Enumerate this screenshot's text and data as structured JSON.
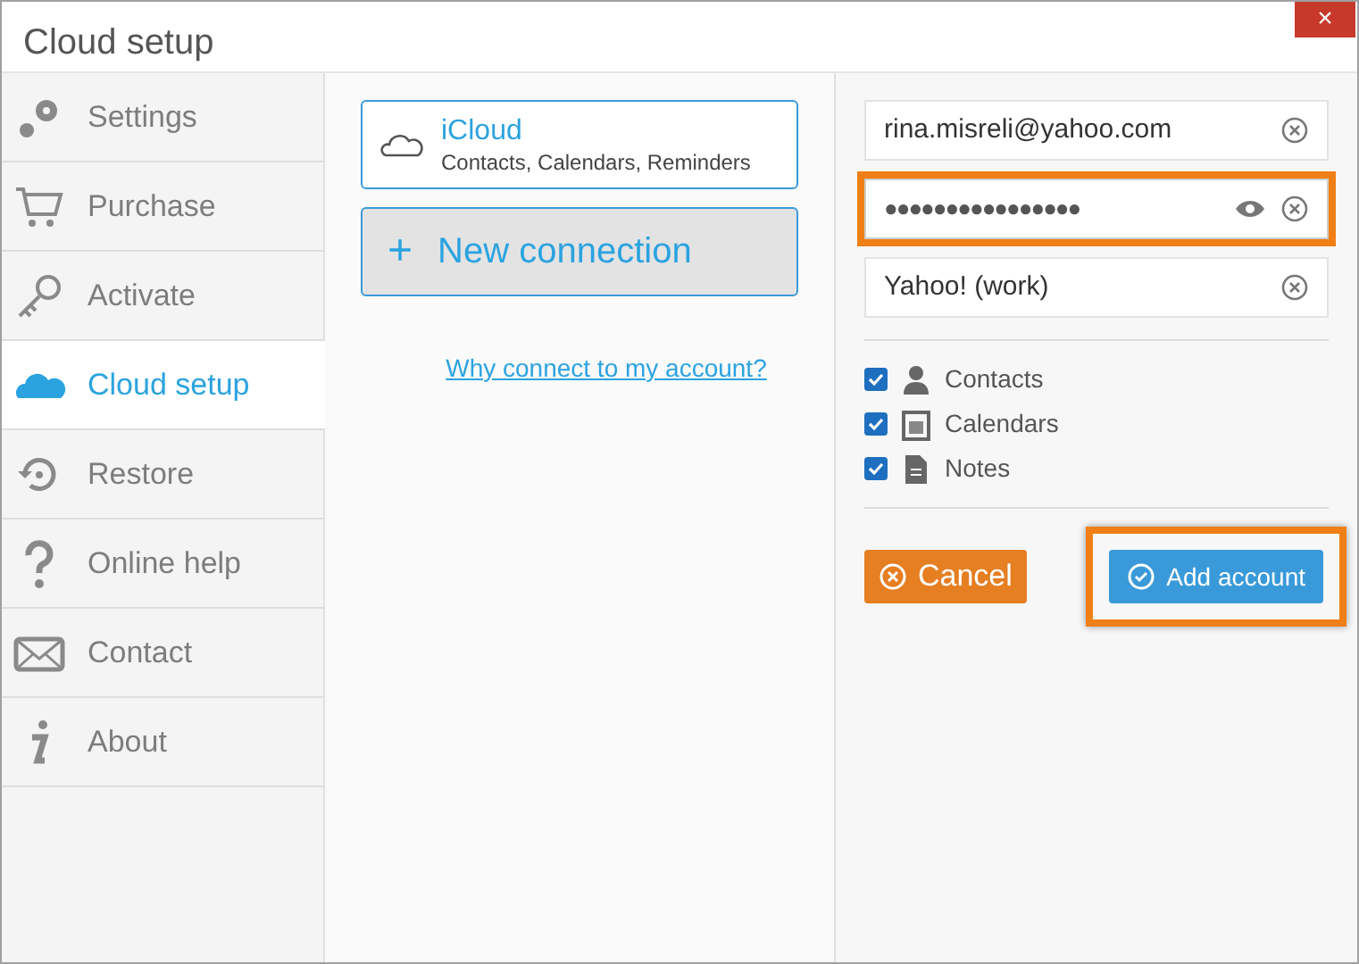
{
  "window": {
    "title": "Cloud setup",
    "close_label": "×"
  },
  "sidebar": {
    "items": [
      {
        "label": "Settings",
        "kind": "gear",
        "selected": false
      },
      {
        "label": "Purchase",
        "kind": "cart",
        "selected": false
      },
      {
        "label": "Activate",
        "kind": "key",
        "selected": false
      },
      {
        "label": "Cloud setup",
        "kind": "cloud",
        "selected": true
      },
      {
        "label": "Restore",
        "kind": "restore",
        "selected": false
      },
      {
        "label": "Online help",
        "kind": "help",
        "selected": false
      },
      {
        "label": "Contact",
        "kind": "mail",
        "selected": false
      },
      {
        "label": "About",
        "kind": "info",
        "selected": false
      }
    ]
  },
  "connections": [
    {
      "name": "iCloud",
      "detail": "Contacts, Calendars, Reminders"
    }
  ],
  "new_connection": {
    "icon": "+",
    "label": "New connection"
  },
  "why_link": "Why connect to my account?",
  "form": {
    "fields": [
      {
        "kind": "text",
        "value": "rina.misreli@yahoo.com",
        "highlighted": false
      },
      {
        "kind": "password",
        "value": "●●●●●●●●●●●●●●●●",
        "highlighted": true
      },
      {
        "kind": "text",
        "value": "Yahoo! (work)",
        "highlighted": false
      }
    ],
    "options": [
      {
        "label": "Contacts",
        "kind": "person",
        "checked": true
      },
      {
        "label": "Calendars",
        "kind": "calendar",
        "checked": true
      },
      {
        "label": "Notes",
        "kind": "note",
        "checked": true
      }
    ],
    "cancel": {
      "label": "Cancel"
    },
    "add": {
      "label": "Add account",
      "highlighted": true
    }
  }
}
